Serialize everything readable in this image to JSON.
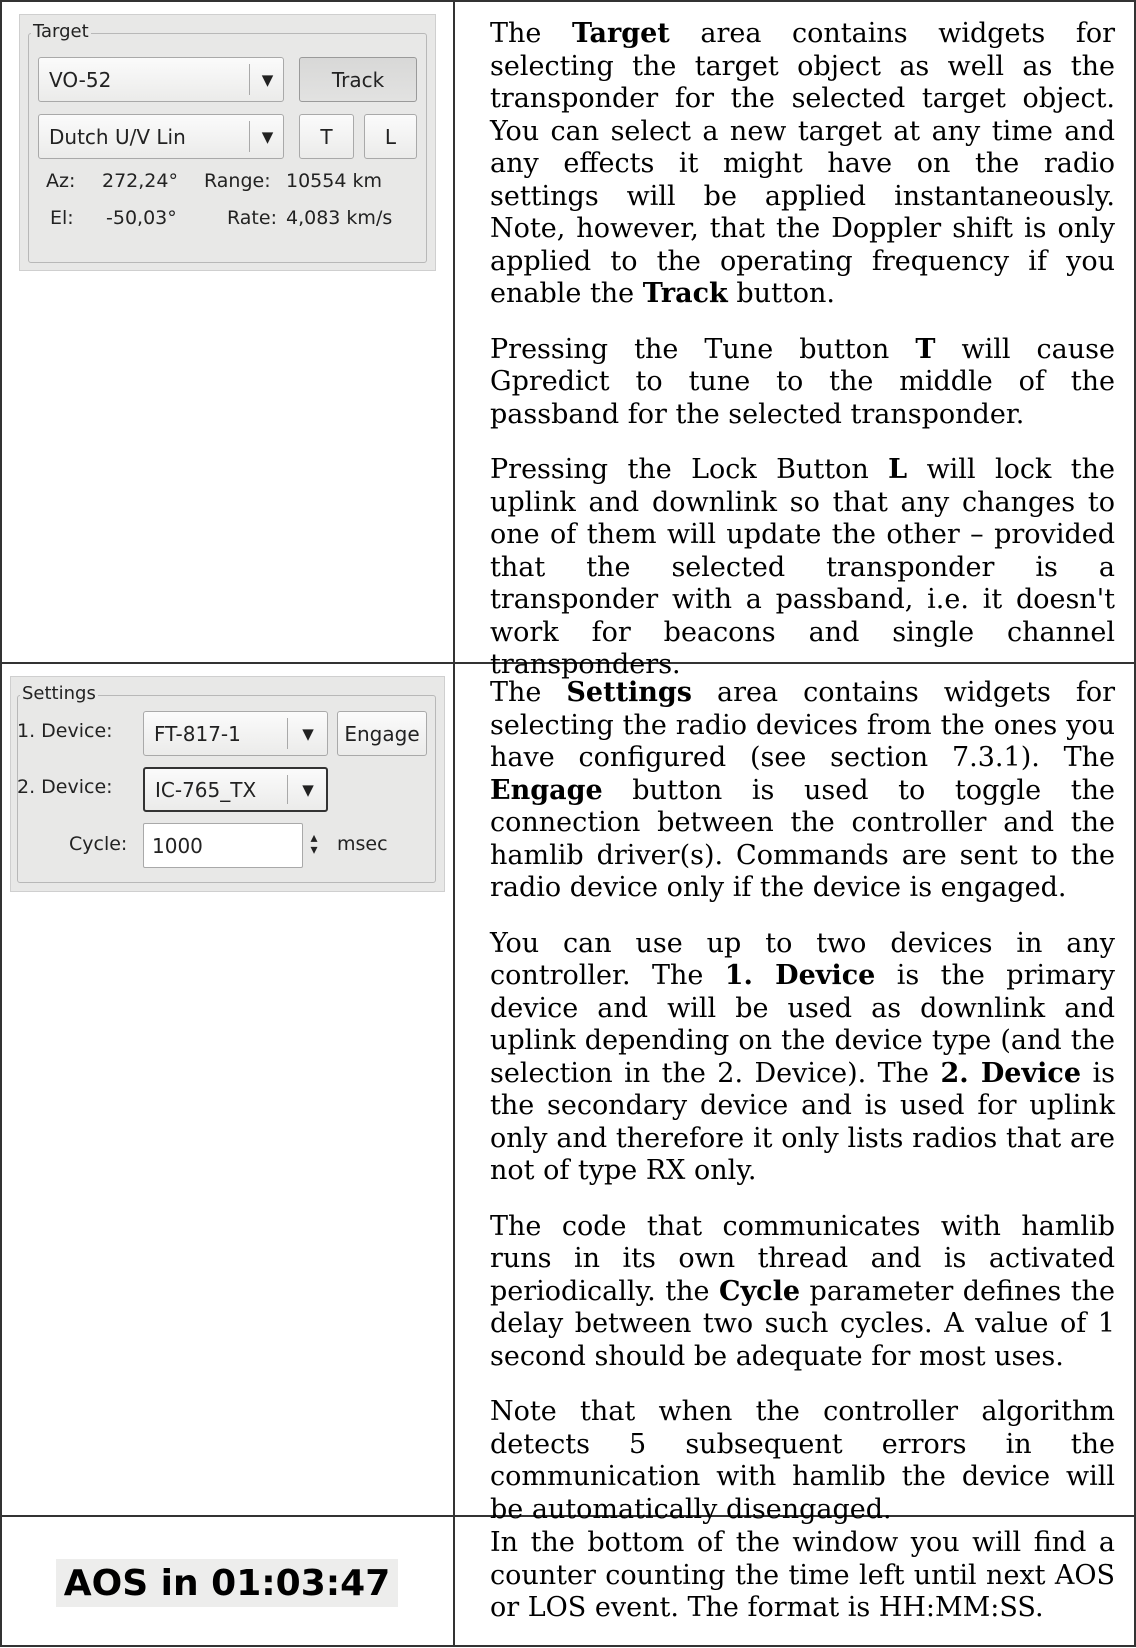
{
  "target_panel": {
    "title": "Target",
    "satellite": "VO-52",
    "track_label": "Track",
    "transponder": "Dutch U/V Lin",
    "tune_label": "T",
    "lock_label": "L",
    "az_label": "Az:",
    "az_value": "272,24°",
    "range_label": "Range:",
    "range_value": "10554 km",
    "el_label": "El:",
    "el_value": "-50,03°",
    "rate_label": "Rate:",
    "rate_value": "4,083 km/s",
    "dropdown_icon": "chevron-down-icon"
  },
  "settings_panel": {
    "title": "Settings",
    "device1_label": "1. Device:",
    "device1_value": "FT-817-1",
    "engage_label": "Engage",
    "device2_label": "2. Device:",
    "device2_value": "IC-765_TX",
    "cycle_label": "Cycle:",
    "cycle_value": "1000",
    "cycle_unit": "msec",
    "spin_icon": "spin-arrows-icon"
  },
  "aos": {
    "text": "AOS in 01:03:47"
  },
  "descriptions": {
    "target_html": [
      "The <b>Target</b> area contains widgets for selecting the target object as well as the transponder for the selected target object. You can select a new target at any time and any effects it might have on the radio settings will be applied instantaneously. Note, however, that the Doppler shift is only applied to the operating frequency if you enable the <b>Track</b> button.",
      "Pressing the Tune button <b>T</b> will cause Gpredict to tune to the middle of the passband for the selected transponder.",
      "Pressing the Lock Button <b>L</b> will lock the uplink and downlink so that any changes to one of them will update the other – provided that the selected transponder is a transponder with a passband, i.e. it doesn't work for beacons and single channel transponders."
    ],
    "settings_html": [
      "The <b>Settings</b> area contains widgets for selecting the radio devices from the ones you have configured (see section 7.3.1). The <b>Engage</b> button is used to toggle the connection between the controller and the hamlib driver(s). Commands are sent to the radio device only if the device is engaged.",
      "You can use up to two devices in any controller. The <b>1. Device</b> is the primary device and will be used as downlink and uplink depending on the device type (and the selection in the 2. Device). The <b>2. Device</b> is the secondary device and is used for uplink only and therefore it only lists radios that are not of type RX only.",
      "The code that communicates with hamlib runs in its own thread and is activated periodically. the <b>Cycle</b> parameter defines the delay between two such cycles. A value of 1 second should be adequate for most uses.",
      "Note that when the controller algorithm detects 5 subsequent errors in the communication with hamlib the device will be automatically disengaged."
    ],
    "aos_html": [
      "In the bottom of the window you will find a counter counting the time left until next AOS or LOS event. The format is HH:MM:SS."
    ]
  }
}
